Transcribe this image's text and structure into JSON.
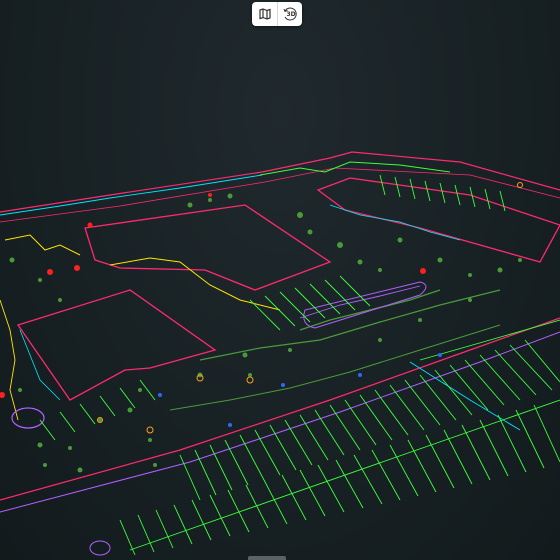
{
  "toolbar": {
    "map_button_icon": "map-icon",
    "view3d_button_icon": "rotate-3d-icon",
    "view3d_label": "3D"
  },
  "viewport": {
    "background": "#172023",
    "colors": {
      "boundary": "#ff2a6d",
      "parking": "#3cff3c",
      "vegetation": "#4a9a3a",
      "utility": "#00e5ff",
      "curb": "#ffe600",
      "markers": "#ff2020",
      "paths": "#b060ff"
    }
  }
}
